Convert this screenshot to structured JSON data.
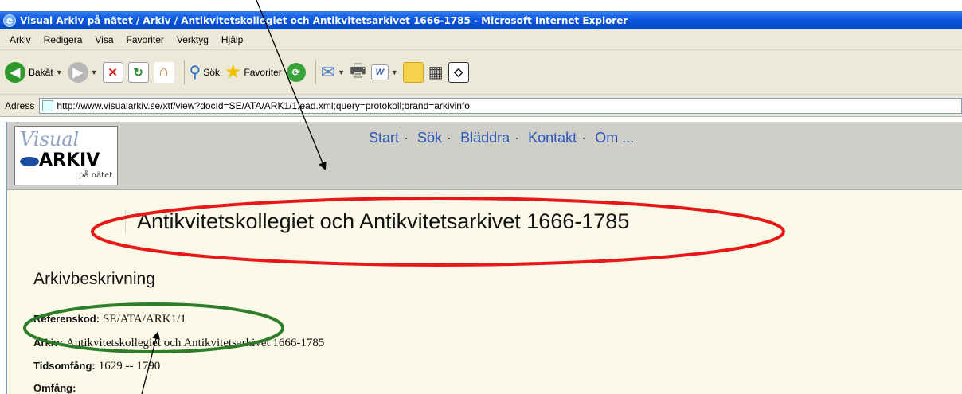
{
  "window": {
    "title": "Visual Arkiv på nätet / Arkiv / Antikvitetskollegiet och Antikvitetsarkivet 1666-1785 - Microsoft Internet Explorer"
  },
  "menu": [
    "Arkiv",
    "Redigera",
    "Visa",
    "Favoriter",
    "Verktyg",
    "Hjälp"
  ],
  "toolbar": {
    "back_label": "Bakåt",
    "search_label": "Sök",
    "favorites_label": "Favoriter"
  },
  "address": {
    "label": "Adress",
    "url": "http://www.visualarkiv.se/xtf/view?docId=SE/ATA/ARK1/1.ead.xml;query=protokoll;brand=arkivinfo"
  },
  "logo": {
    "line1": "Visual",
    "line2": "ARKIV",
    "line3": "på nätet"
  },
  "nav": [
    "Start",
    "Sök",
    "Bläddra",
    "Kontakt",
    "Om ..."
  ],
  "content": {
    "title": "Antikvitetskollegiet och Antikvitetsarkivet 1666-1785",
    "section": "Arkivbeskrivning",
    "fields": [
      {
        "label": "Referenskod:",
        "value": "SE/ATA/ARK1/1"
      },
      {
        "label": "Arkiv:",
        "value": "Antikvitetskollegiet och Antikvitetsarkivet 1666-1785"
      },
      {
        "label": "Tidsomfång:",
        "value": "1629 -- 1790"
      },
      {
        "label": "Omfång:",
        "value": ""
      }
    ]
  },
  "colors": {
    "title_bar": "#0a58e0",
    "chrome": "#ece9d8",
    "nav_link": "#2a55b8",
    "page_bg": "#fbf9e8",
    "annotation_red": "#e81818",
    "annotation_green": "#2e7d2a"
  }
}
